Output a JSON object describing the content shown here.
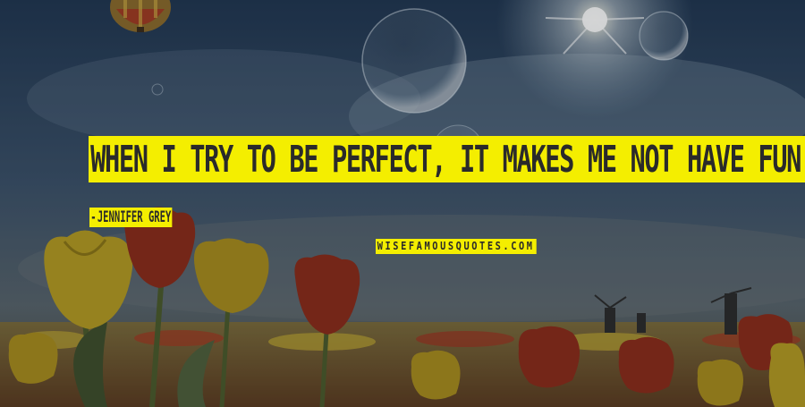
{
  "quote": {
    "text": "WHEN I TRY TO BE PERFECT, IT MAKES ME NOT HAVE FUN.",
    "author": "JENNIFER GREY",
    "author_prefix": "-"
  },
  "watermark": {
    "text": "WISEFAMOUSQUOTES.COM"
  },
  "colors": {
    "highlight": "#f4ee00",
    "text": "#2a2a2a",
    "sky_top": "#2a3c52",
    "sky_bottom": "#5a6a78"
  },
  "background": {
    "icons": [
      "hot-air-balloon-icon",
      "bubble-icon",
      "sun-icon",
      "tulip-icon",
      "windmill-icon"
    ]
  }
}
